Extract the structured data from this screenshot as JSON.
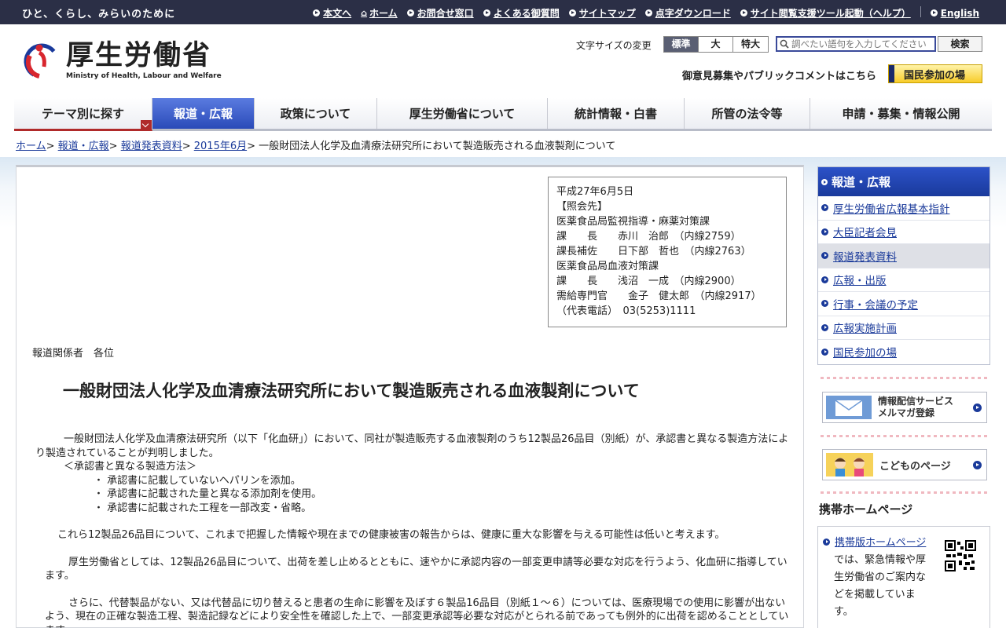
{
  "topbar": {
    "tagline": "ひと、くらし、みらいのために",
    "links": [
      "本文へ",
      "ホーム",
      "お問合せ窓口",
      "よくある御質問",
      "サイトマップ",
      "点字ダウンロード",
      "サイト閲覧支援ツール起動（ヘルプ）"
    ],
    "english": "English"
  },
  "header": {
    "logo_jp": "厚生労働省",
    "logo_en": "Ministry of Health, Labour and Welfare",
    "font_size_label": "文字サイズの変更",
    "font_sizes": [
      "標準",
      "大",
      "特大"
    ],
    "search_placeholder": "調べたい語句を入力してください",
    "search_button": "検索",
    "opinion_link": "御意見募集やパブリックコメントはこちら",
    "kokumin_button": "国民参加の場"
  },
  "nav": {
    "items": [
      "テーマ別に探す",
      "報道・広報",
      "政策について",
      "厚生労働省について",
      "統計情報・白書",
      "所管の法令等",
      "申請・募集・情報公開"
    ]
  },
  "breadcrumb": {
    "links": [
      "ホーム",
      "報道・広報",
      "報道発表資料",
      "2015年6月"
    ],
    "current": "一般財団法人化学及血清療法研究所において製造販売される血液製剤について"
  },
  "contact": {
    "lines": [
      "平成27年6月5日",
      "【照会先】",
      "医薬食品局監視指導・麻薬対策課",
      "課　　長　　赤川　治郎　（内線2759）",
      "課長補佐　　日下部　哲也　（内線2763）",
      "医薬食品局血液対策課",
      "課　　長　　浅沼　一成　（内線2900）",
      "需給専門官　　金子　健太郎　（内線2917）",
      "（代表電話）　03(5253)1111"
    ]
  },
  "article": {
    "addressee": "報道関係者　各位",
    "title": "一般財団法人化学及血清療法研究所において製造販売される血液製剤について",
    "p1": "一般財団法人化学及血清療法研究所（以下「化血研」）において、同社が製造販売する血液製剤のうち12製品26品目（別紙）が、承認書と異なる製造方法により製造されていることが判明しました。",
    "p1_sub": "＜承認書と異なる製造方法＞",
    "bullets": [
      "・ 承認書に記載していないヘパリンを添加。",
      "・ 承認書に記載された量と異なる添加剤を使用。",
      "・ 承認書に記載された工程を一部改変・省略。"
    ],
    "p2": "これら12製品26品目について、これまで把握した情報や現在までの健康被害の報告からは、健康に重大な影響を与える可能性は低いと考えます。",
    "p3": "厚生労働省としては、12製品26品目について、出荷を差し止めるとともに、速やかに承認内容の一部変更申請等必要な対応を行うよう、化血研に指導しています。",
    "p4": "さらに、代替製品がない、又は代替品に切り替えると患者の生命に影響を及ぼす６製品16品目（別紙１～６）については、医療現場での使用に影響が出ないよう、現在の正確な製造工程、製造記録などにより安全性を確認した上で、一部変更承認等必要な対応がとられる前であっても例外的に出荷を認めることとしています。"
  },
  "sidebar": {
    "heading": "報道・広報",
    "items": [
      "厚生労働省広報基本指針",
      "大臣記者会見",
      "報道発表資料",
      "広報・出版",
      "行事・会議の予定",
      "広報実施計画",
      "国民参加の場"
    ],
    "mail_banner": [
      "情報配信サービス",
      "メルマガ登録"
    ],
    "kids_banner": "こどものページ",
    "mobile_title": "携帯ホームページ",
    "mobile_link": "携帯版ホームページ",
    "mobile_text": "では、緊急情報や厚生労働省のご案内などを掲載しています。"
  }
}
